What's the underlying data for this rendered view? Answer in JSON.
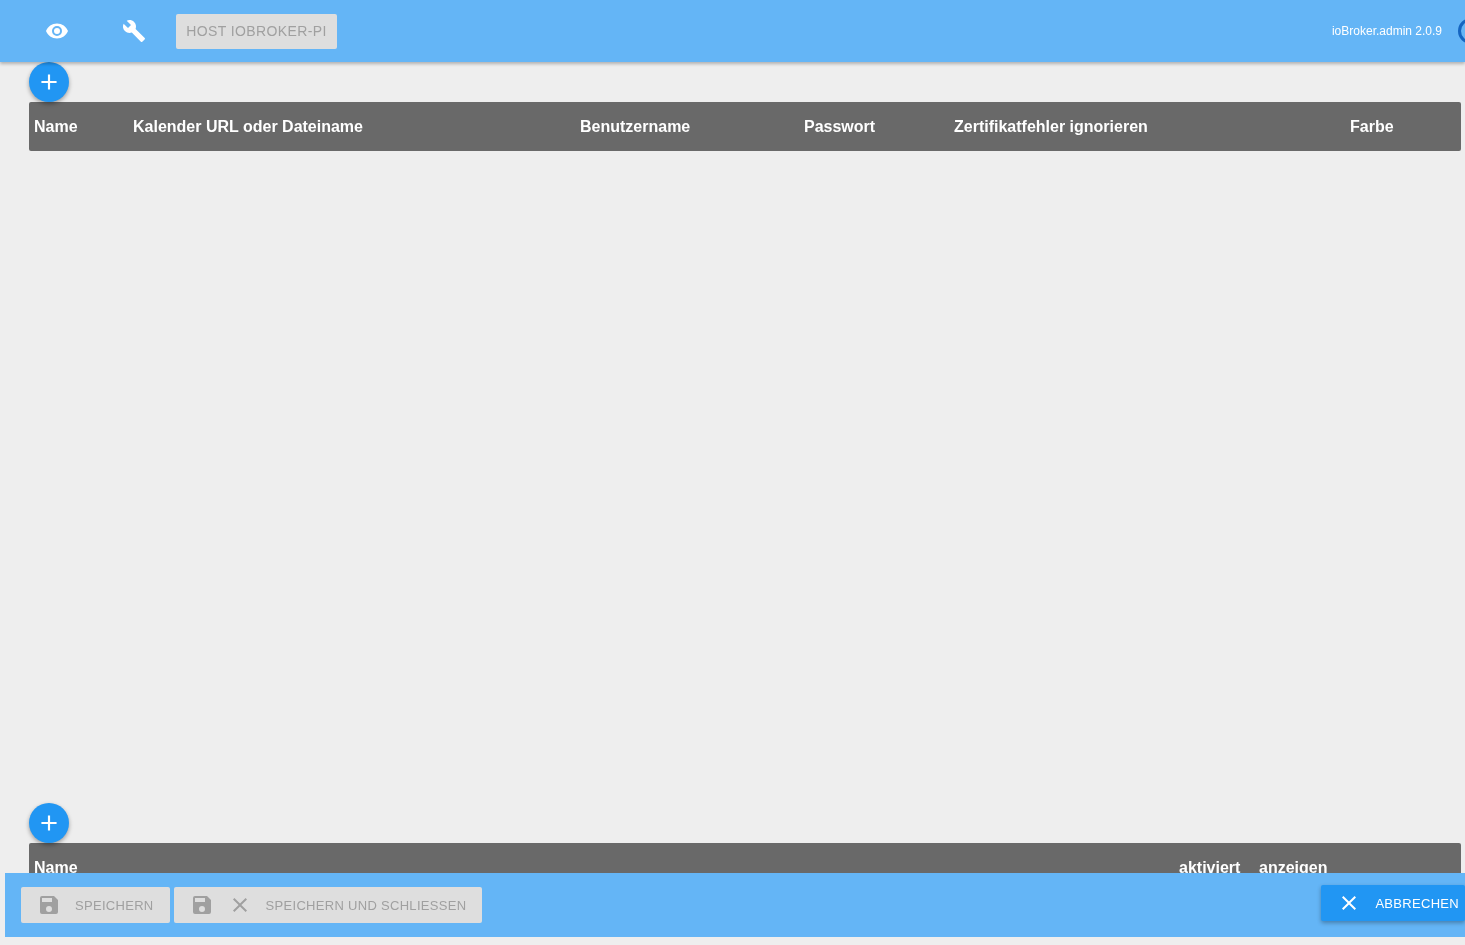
{
  "toolbar": {
    "host_button": "HOST IOBROKER-PI",
    "version": "ioBroker.admin 2.0.9"
  },
  "tables": [
    {
      "columns": [
        "Name",
        "Kalender URL oder Dateiname",
        "Benutzername",
        "Passwort",
        "Zertifikatfehler ignorieren",
        "Farbe"
      ]
    },
    {
      "columns": [
        "Name",
        "aktiviert",
        "anzeigen"
      ]
    }
  ],
  "footer": {
    "buttons": [
      {
        "label": "SPEICHERN",
        "kind": "save",
        "disabled": true
      },
      {
        "label": "SPEICHERN UND SCHLIESSEN",
        "kind": "save-close",
        "disabled": true
      },
      {
        "label": "ABBRECHEN",
        "kind": "cancel",
        "disabled": false
      }
    ]
  }
}
